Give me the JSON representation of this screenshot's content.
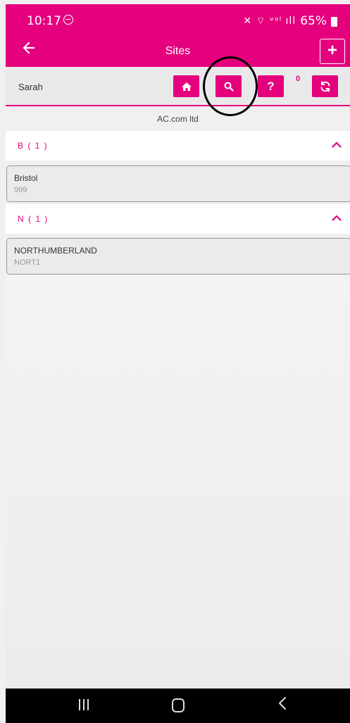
{
  "status_bar": {
    "time": "10:17",
    "signal_icons": "✕ ⌔ ᵛᵒˡ ıll",
    "battery": "65%"
  },
  "app_bar": {
    "title": "Sites",
    "add_label": "+"
  },
  "toolbar": {
    "user": "Sarah",
    "help_label": "?",
    "notification_count": "0"
  },
  "company": "AC.com ltd",
  "groups": [
    {
      "label": "B ( 1 )",
      "sites": [
        {
          "name": "Bristol",
          "code": "999"
        }
      ]
    },
    {
      "label": "N ( 1 )",
      "sites": [
        {
          "name": "NORTHUMBERLAND",
          "code": "NORT1"
        }
      ]
    }
  ],
  "colors": {
    "accent": "#e5007e",
    "toolbar_bg": "#e9e9e9",
    "card_bg": "#ebebeb"
  }
}
